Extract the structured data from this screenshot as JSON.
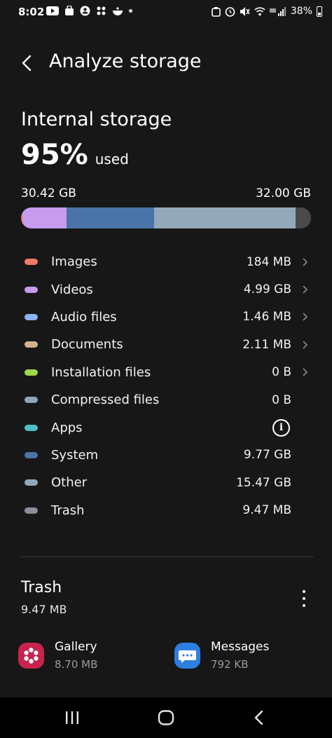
{
  "status_bar": {
    "time": "8:02",
    "battery": "38%",
    "left_icons": [
      "youtube-icon",
      "shopping-bag-icon",
      "account-icon",
      "dots-icon",
      "bowl-icon",
      "dot-icon"
    ],
    "right_icons": [
      "alarm-icon",
      "clock-icon",
      "mute-icon",
      "wifi-icon",
      "signal-icon",
      "battery-icon"
    ]
  },
  "header": {
    "title": "Analyze storage"
  },
  "storage": {
    "title": "Internal storage",
    "percent": "95%",
    "used_label": "used",
    "used_amount": "30.42 GB",
    "total_amount": "32.00 GB",
    "bar": [
      {
        "name": "images",
        "fraction": 0.006,
        "color": "#ee7a6a"
      },
      {
        "name": "videos",
        "fraction": 0.152,
        "color": "#c79bee"
      },
      {
        "name": "system",
        "fraction": 0.3,
        "color": "#4a73a8"
      },
      {
        "name": "other",
        "fraction": 0.49,
        "color": "#93a8b8"
      },
      {
        "name": "free",
        "fraction": 0.052,
        "color": "#4a4a4a"
      }
    ]
  },
  "categories": [
    {
      "label": "Images",
      "size": "184 MB",
      "color": "#ee7a6a",
      "chevron": true
    },
    {
      "label": "Videos",
      "size": "4.99 GB",
      "color": "#c79bee",
      "chevron": true
    },
    {
      "label": "Audio files",
      "size": "1.46 MB",
      "color": "#8cb3f2",
      "chevron": true
    },
    {
      "label": "Documents",
      "size": "2.11 MB",
      "color": "#d3b28c",
      "chevron": true
    },
    {
      "label": "Installation files",
      "size": "0 B",
      "color": "#9fd84a",
      "chevron": true
    },
    {
      "label": "Compressed files",
      "size": "0 B",
      "color": "#8fa4bc",
      "chevron": false
    },
    {
      "label": "Apps",
      "size": "",
      "color": "#4fc0c4",
      "chevron": false,
      "info": "i"
    },
    {
      "label": "System",
      "size": "9.77 GB",
      "color": "#4a73a8",
      "chevron": false
    },
    {
      "label": "Other",
      "size": "15.47 GB",
      "color": "#93a8b8",
      "chevron": false
    },
    {
      "label": "Trash",
      "size": "9.47 MB",
      "color": "#8a8e98",
      "chevron": false
    }
  ],
  "trash": {
    "title": "Trash",
    "size": "9.47 MB",
    "apps": [
      {
        "name": "Gallery",
        "size": "8.70 MB",
        "color": "#c8234f"
      },
      {
        "name": "Messages",
        "size": "792 KB",
        "color": "#2d7fe0"
      }
    ]
  }
}
